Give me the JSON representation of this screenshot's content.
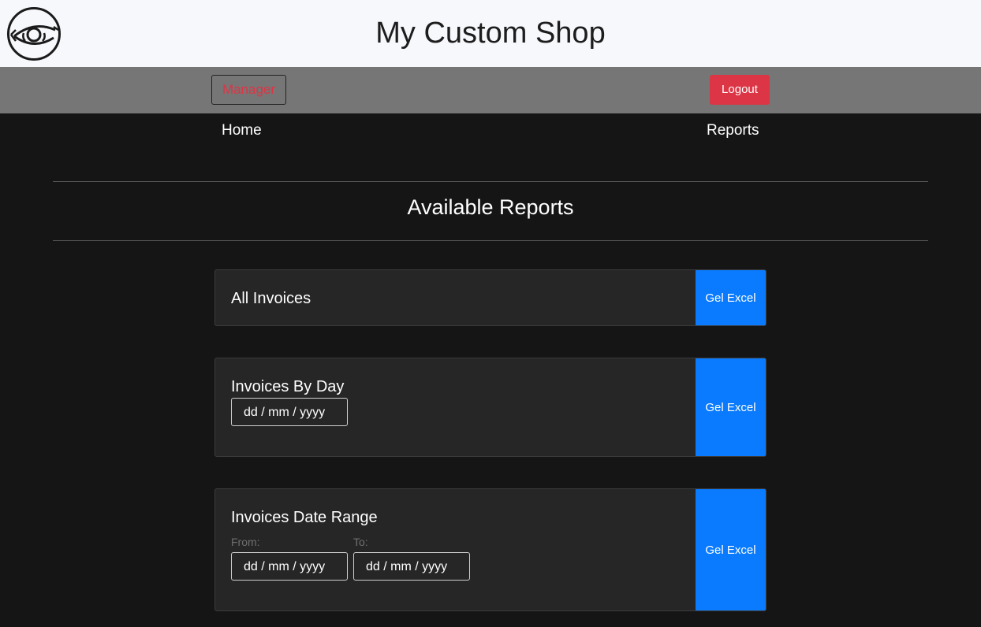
{
  "header": {
    "title": "My Custom Shop",
    "logo_icon": "eye-icon"
  },
  "userbar": {
    "role_label": "Manager",
    "logout_label": "Logout"
  },
  "nav": {
    "home": "Home",
    "reports": "Reports"
  },
  "main": {
    "section_title": "Available Reports",
    "reports": [
      {
        "title": "All Invoices",
        "button": "Gel Excel"
      },
      {
        "title": "Invoices By Day",
        "button": "Gel Excel",
        "date_placeholder": "dd / mm / yyyy"
      },
      {
        "title": "Invoices Date Range",
        "button": "Gel Excel",
        "from_label": "From:",
        "to_label": "To:",
        "from_placeholder": "dd / mm / yyyy",
        "to_placeholder": "dd / mm / yyyy"
      }
    ]
  },
  "colors": {
    "background": "#151515",
    "card": "#262626",
    "primary": "#0a7bff",
    "danger": "#dc3545",
    "header": "#f7f8fc",
    "userbar": "#767676"
  }
}
